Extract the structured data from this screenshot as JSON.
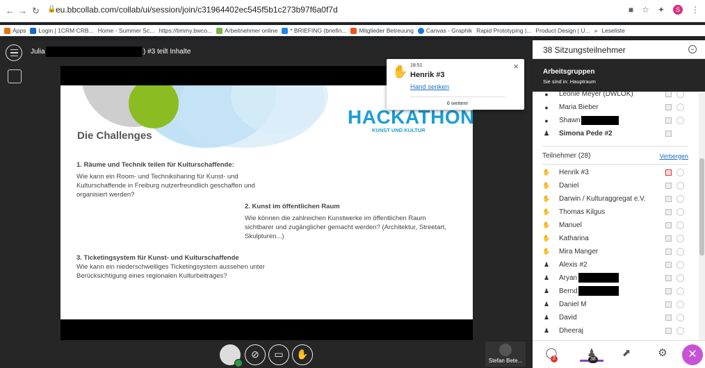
{
  "browser": {
    "url": "eu.bbcollab.com/collab/ui/session/join/c31964402ec545f5b1c273b97f6a0f7d",
    "profile_initial": "S",
    "bookmarks": [
      "Apps",
      "Login | 1CRM CRB...",
      "Home - Summer Sc...",
      "https://timmy.bwco...",
      "Arbeitnehmer online",
      "* BRIEFING (briefin...",
      "Mitglieder Betreuung",
      "Canvas - Graphik",
      "Rapid Prototyping |...",
      "Product Design | U...",
      "»",
      "Leseliste"
    ]
  },
  "session": {
    "presenter_first": "Julia",
    "share_suffix": ") #3 teilt Inhalte",
    "stefan_label": "Stefan Bete..."
  },
  "slide": {
    "logo_main": "HACKATHON",
    "logo_sub": "KUNST UND KULTUR",
    "title": "Die Challenges",
    "c1_title": "1. Räume und Technik teilen für Kulturschaffende:",
    "c1_body": "Wie kann ein Room- und Techniksharing für Kunst- und Kulturschaffende in Freiburg nutzerfreundlich geschaffen und organisiert werden?",
    "c2_title": "2. Kunst im öffentlichen Raum",
    "c2_body": "Wie können die zahlreichen Kunstwerke im öffentlichen Raum sichtbarer und zugänglicher gemacht werden? (Architektur, Streetart, Skulpturen...)",
    "c3_title": "3. Ticketingsystem für Kunst- und Kulturschaffende",
    "c3_body": "Wie kann ein niederschwelliges Ticketingsystem aussehen unter Berücksichtigung eines regionalen Kulturbeitrages?"
  },
  "notification": {
    "time": "18:51",
    "name": "Henrik #3",
    "action": "Hand senken",
    "more": "6 weitere"
  },
  "panel": {
    "title": "38 Sitzungsteilnehmer",
    "groups_title": "Arbeitsgruppen",
    "groups_sub": "Sie sind in: Hauptraum",
    "top_rows": [
      "Leonie Meyer (DWLOK)",
      "Maria Bieber",
      "Shawn",
      "Simona Pede #2"
    ],
    "section_label": "Teilnehmer (28)",
    "section_link": "Verbergen",
    "participants": [
      "Henrik #3",
      "Daniel",
      "Darwin / Kulturaggregat e.V.",
      "Thomas Kilgus",
      "Manuel",
      "Katharina",
      "Mira Manger",
      "Alexis #2",
      "Aryan",
      "Bernd",
      "Daniel M",
      "David",
      "Dheeraj"
    ],
    "chat_badge": "2",
    "participants_badge": "38"
  },
  "colors": {
    "accent": "#8a3fb6",
    "logo": "#1a9ed6",
    "bar": "#262626"
  }
}
